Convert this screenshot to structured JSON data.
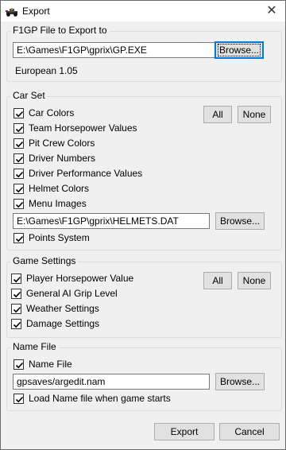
{
  "window": {
    "title": "Export",
    "icon": "f1-car-icon",
    "close": "✕"
  },
  "file_group": {
    "legend": "F1GP File to Export to",
    "path": "E:\\Games\\F1GP\\gprix\\GP.EXE",
    "browse_label": "Browse...",
    "version": "European 1.05"
  },
  "car_set": {
    "legend": "Car Set",
    "all_label": "All",
    "none_label": "None",
    "items": [
      {
        "label": "Car Colors",
        "checked": true
      },
      {
        "label": "Team Horsepower Values",
        "checked": true
      },
      {
        "label": "Pit Crew Colors",
        "checked": true
      },
      {
        "label": "Driver Numbers",
        "checked": true
      },
      {
        "label": "Driver Performance Values",
        "checked": true
      },
      {
        "label": "Helmet Colors",
        "checked": true
      },
      {
        "label": "Menu Images",
        "checked": true
      }
    ],
    "helmets_path": "E:\\Games\\F1GP\\gprix\\HELMETS.DAT",
    "browse_label": "Browse...",
    "points": {
      "label": "Points System",
      "checked": true
    }
  },
  "game_settings": {
    "legend": "Game Settings",
    "all_label": "All",
    "none_label": "None",
    "items": [
      {
        "label": "Player Horsepower Value",
        "checked": true
      },
      {
        "label": "General AI Grip Level",
        "checked": true
      },
      {
        "label": "Weather Settings",
        "checked": true
      },
      {
        "label": "Damage Settings",
        "checked": true
      }
    ]
  },
  "name_file": {
    "legend": "Name File",
    "checkbox": {
      "label": "Name File",
      "checked": true
    },
    "path": "gpsaves/argedit.nam",
    "browse_label": "Browse...",
    "load_checkbox": {
      "label": "Load Name file when game starts",
      "checked": true
    }
  },
  "footer": {
    "export_label": "Export",
    "cancel_label": "Cancel"
  }
}
